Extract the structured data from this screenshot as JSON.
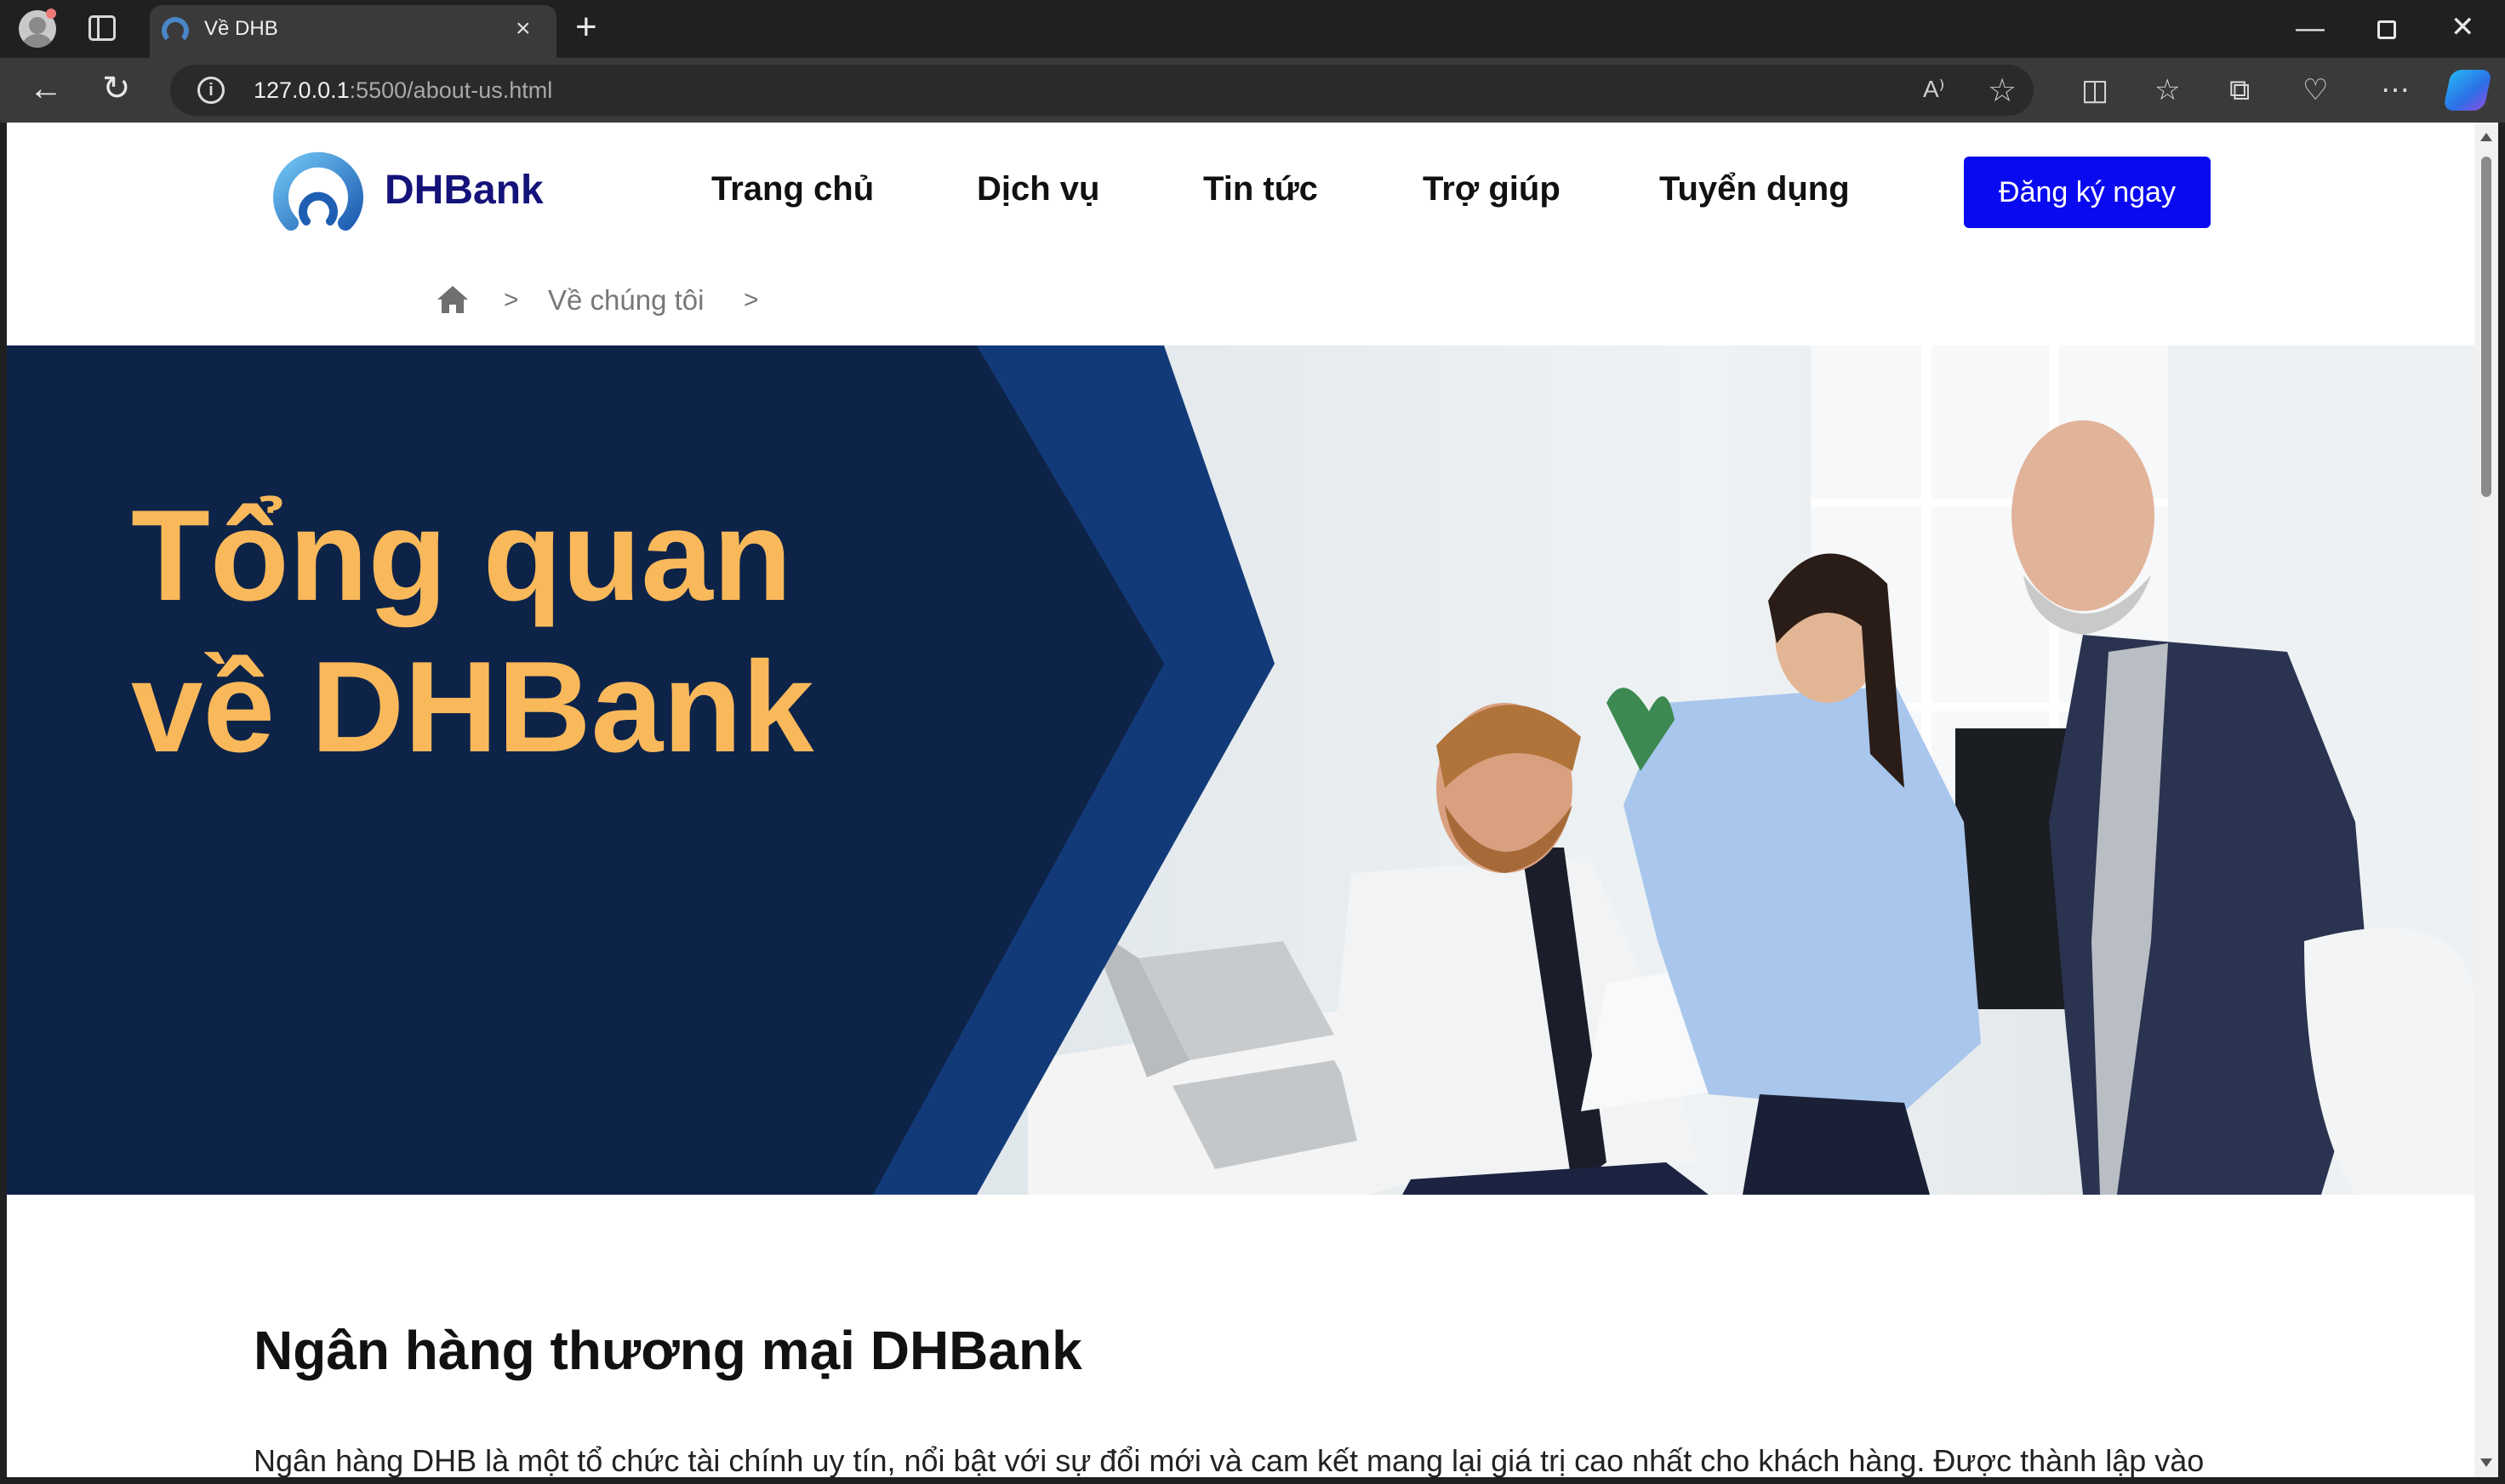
{
  "browser": {
    "tab_title": "Về DHB",
    "tab_close": "×",
    "new_tab": "+",
    "url_host": "127.0.0.1",
    "url_path": ":5500/about-us.html",
    "icons": [
      "profile-icon",
      "tab-actions-icon",
      "back-icon",
      "refresh-icon",
      "site-info-icon",
      "read-aloud-icon",
      "favorite-star-icon",
      "split-screen-icon",
      "favorites-icon",
      "collections-icon",
      "browser-essentials-icon",
      "more-icon",
      "copilot-icon"
    ],
    "read_aloud": "A⁾",
    "window_controls": {
      "minimize": "—",
      "close": "✕"
    }
  },
  "site": {
    "logo_text": "DHBank",
    "nav": [
      "Trang chủ",
      "Dịch vụ",
      "Tin tức",
      "Trợ giúp",
      "Tuyển dụng"
    ],
    "cta_label": "Đăng ký ngay",
    "brand_color": "#14137a",
    "cta_color": "#0a0af0"
  },
  "breadcrumb": {
    "separator": ">",
    "current": "Về chúng tôi"
  },
  "hero": {
    "title": "Tổng quan\nvề DHBank",
    "title_color": "#f9b95b",
    "panel_color": "#0e2348",
    "chevron_color": "#133a78"
  },
  "content": {
    "heading": "Ngân hàng thương mại DHBank",
    "paragraph": "Ngân hàng DHB là một tổ chức tài chính uy tín, nổi bật với sự đổi mới và cam kết mang lại giá trị cao nhất cho khách hàng. Được thành lập vào"
  }
}
